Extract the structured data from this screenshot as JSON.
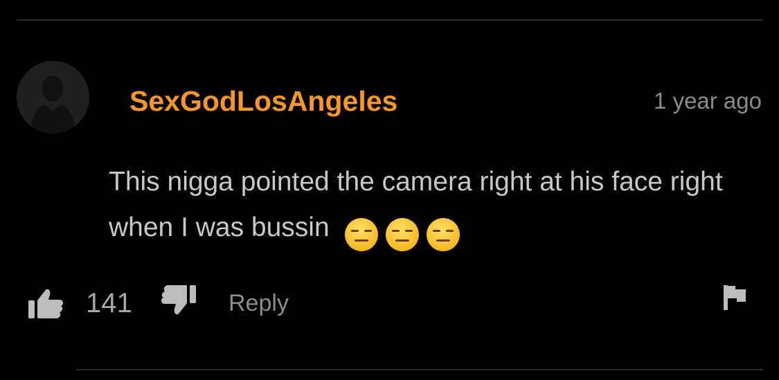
{
  "comment": {
    "username": "SexGodLosAngeles",
    "timestamp": "1 year ago",
    "text": "This nigga pointed the camera right at his face right when I was bussin",
    "emojis": [
      "expressionless-face",
      "expressionless-face",
      "expressionless-face"
    ],
    "like_count": "141",
    "reply_label": "Reply"
  },
  "icons": {
    "like": "thumbs-up-icon",
    "dislike": "thumbs-down-icon",
    "flag": "flag-icon",
    "avatar": "default-user-silhouette"
  },
  "colors": {
    "background": "#000000",
    "username": "#f7962b",
    "body_text": "#c8c8c8",
    "muted_text": "#8c8c8c",
    "icon": "#bdbdbd",
    "divider": "#2b2b2b"
  }
}
